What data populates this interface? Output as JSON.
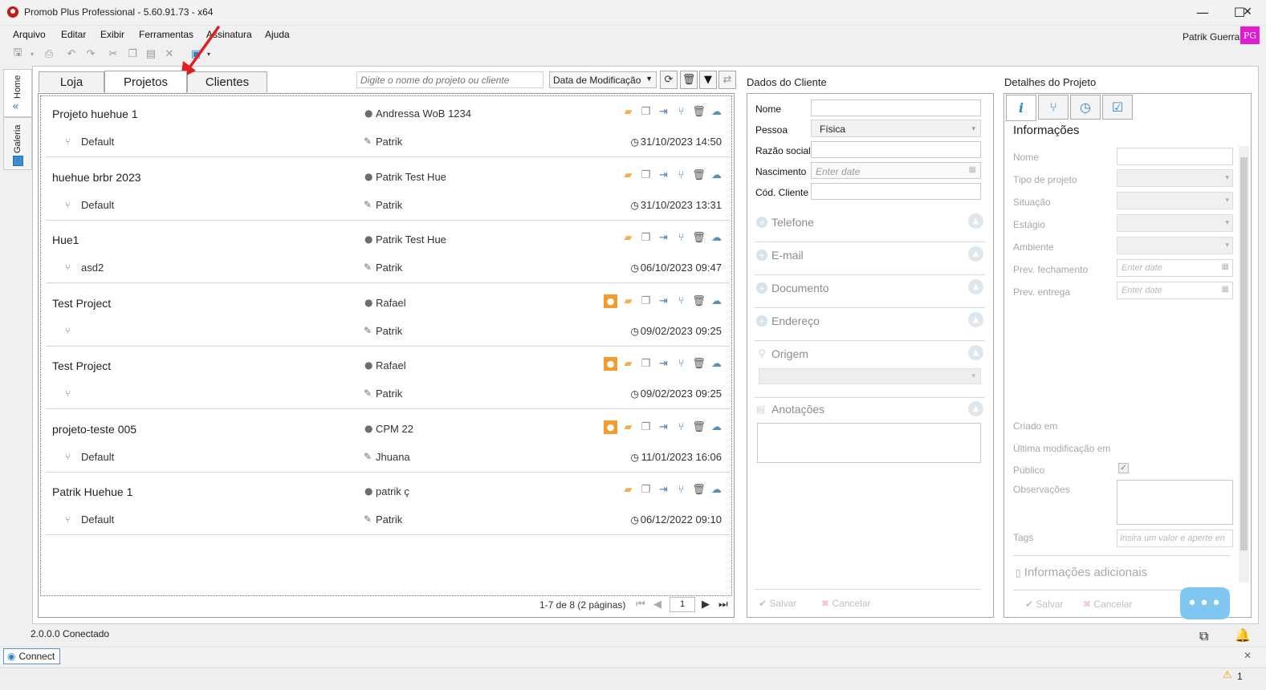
{
  "window": {
    "title": "Promob Plus Professional - 5.60.91.73 - x64",
    "minimize": "—",
    "maximize": "☐",
    "close": "✕"
  },
  "menu": [
    "Arquivo",
    "Editar",
    "Exibir",
    "Ferramentas",
    "Assinatura",
    "Ajuda"
  ],
  "user": {
    "name": "Patrik Guerra",
    "initials": "PG",
    "badge_color": "#e11bd4"
  },
  "side_tabs": [
    "Home",
    "Galeria"
  ],
  "project_tabs": {
    "loja": "Loja",
    "projetos": "Projetos",
    "clientes": "Clientes",
    "active": "Projetos"
  },
  "search": {
    "placeholder": "Digite o nome do projeto ou cliente"
  },
  "sort": {
    "selected": "Data de Modificação"
  },
  "projects": [
    {
      "name": "Projeto huehue 1",
      "version": "Default",
      "client": "Andressa WoB 1234",
      "user": "Patrik",
      "date": "31/10/2023 14:50",
      "client_badge": false
    },
    {
      "name": "huehue brbr 2023",
      "version": "Default",
      "client": "Patrik Test Hue",
      "user": "Patrik",
      "date": "31/10/2023 13:31",
      "client_badge": false
    },
    {
      "name": "Hue1",
      "version": "asd2",
      "client": "Patrik Test Hue",
      "user": "Patrik",
      "date": "06/10/2023 09:47",
      "client_badge": false
    },
    {
      "name": "Test Project",
      "version": "",
      "client": "Rafael",
      "user": "Patrik",
      "date": "09/02/2023 09:25",
      "client_badge": true
    },
    {
      "name": "Test Project",
      "version": "",
      "client": "Rafael",
      "user": "Patrik",
      "date": "09/02/2023 09:25",
      "client_badge": true
    },
    {
      "name": "projeto-teste 005",
      "version": "Default",
      "client": "CPM 22",
      "user": "Jhuana",
      "date": "11/01/2023 16:06",
      "client_badge": true
    },
    {
      "name": "Patrik Huehue 1",
      "version": "Default",
      "client": "patrik ç",
      "user": "Patrik",
      "date": "06/12/2022 09:10",
      "client_badge": false
    }
  ],
  "pager": {
    "summary": "1-7 de 8 (2 páginas)",
    "page": "1"
  },
  "client_panel": {
    "title": "Dados do Cliente",
    "labels": {
      "nome": "Nome",
      "pessoa": "Pessoa",
      "razao": "Razão social",
      "nascimento": "Nascimento",
      "codigo": "Cód. Cliente"
    },
    "pessoa_value": "Física",
    "date_placeholder": "Enter date",
    "sections": {
      "telefone": "Telefone",
      "email": "E-mail",
      "documento": "Documento",
      "endereco": "Endereço",
      "origem": "Origem",
      "anotacoes": "Anotações"
    },
    "save": "Salvar",
    "cancel": "Cancelar"
  },
  "details_panel": {
    "title": "Detalhes do Projeto",
    "heading": "Informações",
    "labels": {
      "nome": "Nome",
      "tipo": "Tipo de projeto",
      "situacao": "Situação",
      "estagio": "Estágio",
      "ambiente": "Ambiente",
      "prev_fech": "Prev. fechamento",
      "prev_entrega": "Prev. entrega",
      "criado": "Criado em",
      "ultima": "Última modificação em",
      "publico": "Público",
      "obs": "Observações",
      "tags": "Tags"
    },
    "date_placeholder": "Enter date",
    "tags_placeholder": "Insira um valor e aperte en",
    "extra_section": "Informações adicionais",
    "publico_checked": true,
    "save": "Salvar",
    "cancel": "Cancelar"
  },
  "status": {
    "version": "2.0.0.0",
    "state": "Conectado",
    "connect": "Connect",
    "warnings": "1"
  },
  "colors": {
    "accent": "#2e85c7",
    "folder": "#f2b24b",
    "client_badge": "#f39c2b",
    "cloud": "#5a8fb8"
  }
}
